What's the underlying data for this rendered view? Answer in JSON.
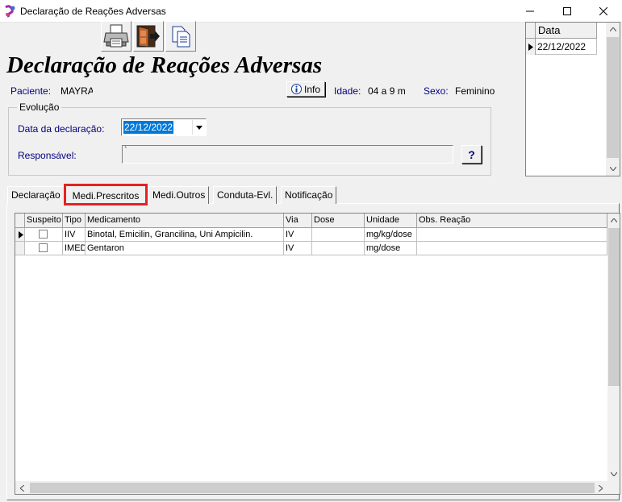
{
  "window": {
    "title": "Declaração de Reações Adversas",
    "minimize": "—",
    "maximize": "☐",
    "close": "✕"
  },
  "header": {
    "title": "Declaração de Reações Adversas"
  },
  "patient": {
    "paciente_label": "Paciente:",
    "paciente_value": "MAYRA",
    "info_button": "Info",
    "idade_label": "Idade:",
    "idade_value": "04 a 9 m",
    "sexo_label": "Sexo:",
    "sexo_value": "Feminino"
  },
  "evolucao": {
    "legend": "Evolução",
    "data_label": "Data da declaração:",
    "data_value": "22/12/2022",
    "responsavel_label": "Responsável:",
    "responsavel_value": "`",
    "help_button": "?"
  },
  "date_grid": {
    "header": "Data",
    "rows": [
      "22/12/2022"
    ]
  },
  "tabs": [
    "Declaração",
    "Medi.Prescritos",
    "Medi.Outros",
    "Conduta-Evl.",
    "Notificação"
  ],
  "table": {
    "columns": [
      "Suspeito",
      "Tipo",
      "Medicamento",
      "Via",
      "Dose",
      "Unidade",
      "Obs. Reação"
    ],
    "rows": [
      {
        "tipo": "IIV",
        "medicamento": "Binotal, Emicilin, Grancilina, Uni Ampicilin.",
        "via": "IV",
        "dose": "",
        "unidade": "mg/kg/dose",
        "obs": ""
      },
      {
        "tipo": "IMED",
        "medicamento": "Gentaron",
        "via": "IV",
        "dose": "",
        "unidade": "mg/dose",
        "obs": ""
      }
    ]
  },
  "colors": {
    "label_blue": "#000080",
    "highlight_tab": "#e32222",
    "selection": "#0078d7"
  }
}
